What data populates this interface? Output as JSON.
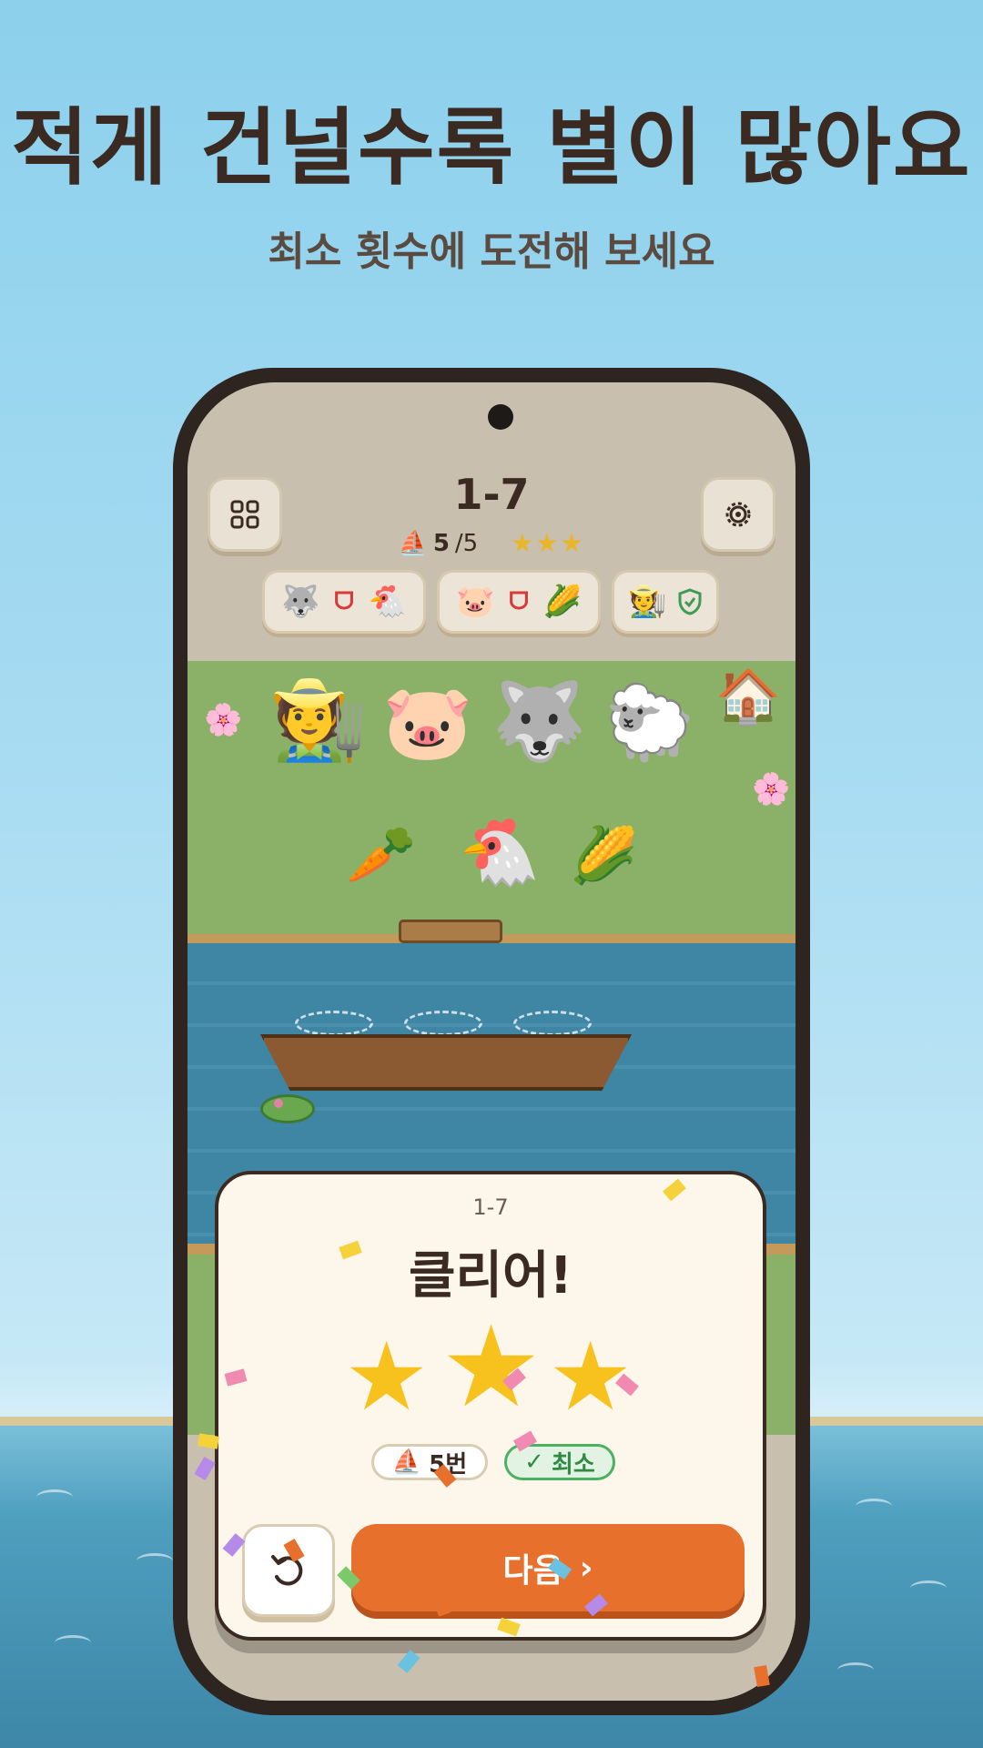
{
  "promo": {
    "headline": "적게 건널수록 별이 많아요",
    "subline": "최소 횟수에 도전해 보세요"
  },
  "game": {
    "level": "1-7",
    "moves_current": "5",
    "moves_limit": "/5",
    "stars": "★★★",
    "menu_icon": "grid-icon",
    "settings_icon": "gear-icon",
    "rules": [
      {
        "a": "🐺",
        "b": "🐔",
        "icon": "mouth-icon"
      },
      {
        "a": "🐷",
        "b": "🌽",
        "icon": "mouth-icon"
      },
      {
        "a": "🧑‍🌾",
        "icon": "shield-icon"
      }
    ],
    "top_row": [
      "🧑‍🌾",
      "🐷",
      "🐺",
      "🐑"
    ],
    "bottom_row": [
      "🥕",
      "🐔",
      "🌽"
    ],
    "house": "🏠",
    "flowers": [
      "🌸",
      "🌸"
    ]
  },
  "result": {
    "level": "1-7",
    "title": "클리어!",
    "stars": [
      "★",
      "★",
      "★"
    ],
    "moves_label": "5번",
    "minimum_label": "최소",
    "next_label": "다음",
    "colors": {
      "accent": "#e8702d",
      "star": "#f7c21e",
      "success": "#4caf62"
    }
  }
}
